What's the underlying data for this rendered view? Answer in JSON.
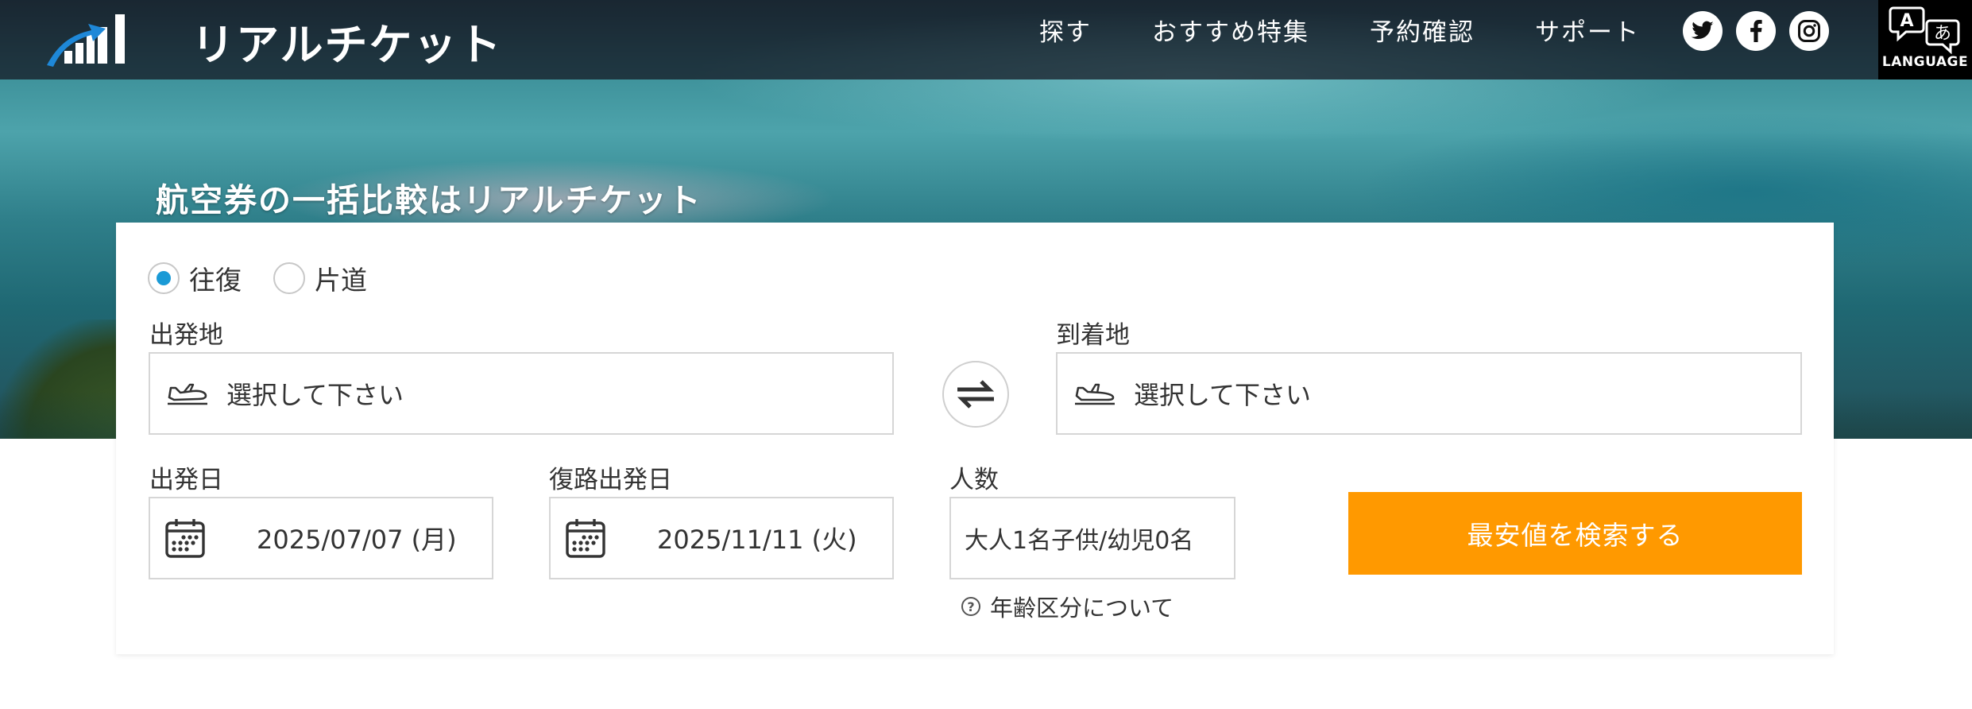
{
  "header": {
    "brand": "リアルチケット",
    "nav": [
      "探す",
      "おすすめ特集",
      "予約確認",
      "サポート"
    ],
    "social": [
      "twitter-icon",
      "facebook-icon",
      "instagram-icon"
    ],
    "language_label": "LANGUAGE",
    "language_glyph_a": "A",
    "language_glyph_b": "あ"
  },
  "hero": {
    "tagline": "航空券の一括比較はリアルチケット"
  },
  "search": {
    "trip_types": [
      {
        "label": "往復",
        "selected": true
      },
      {
        "label": "片道",
        "selected": false
      }
    ],
    "origin": {
      "label": "出発地",
      "placeholder": "選択して下さい"
    },
    "destination": {
      "label": "到着地",
      "placeholder": "選択して下さい"
    },
    "depart_date": {
      "label": "出発日",
      "value": "2025/07/07 (月)"
    },
    "return_date": {
      "label": "復路出発日",
      "value": "2025/11/11 (火)"
    },
    "passengers": {
      "label": "人数",
      "value": "大人1名子供/幼児0名"
    },
    "age_info_link": "年齢区分について",
    "age_info_glyph": "?",
    "submit_label": "最安値を検索する"
  },
  "colors": {
    "accent": "#ff9900",
    "radio": "#1a9ad6",
    "header_bg": "#14141e"
  }
}
